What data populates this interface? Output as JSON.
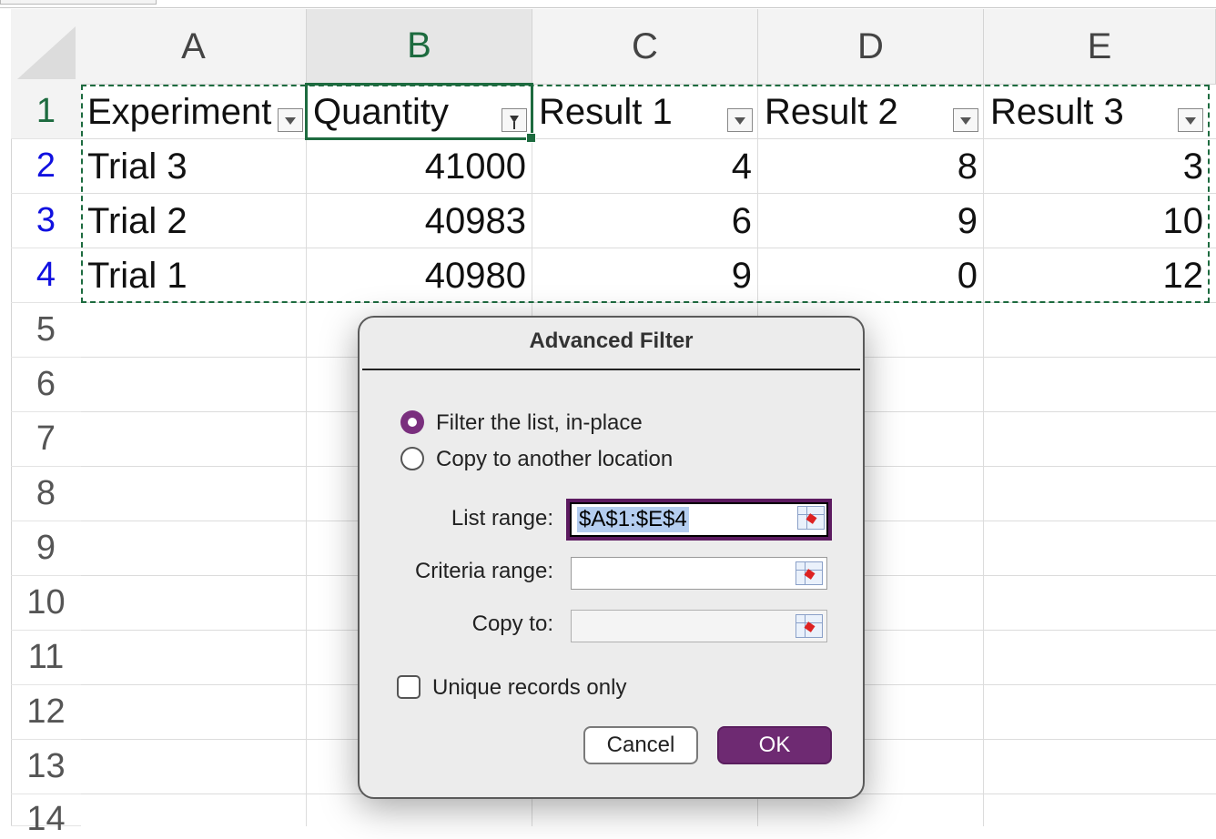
{
  "columns": [
    "A",
    "B",
    "C",
    "D",
    "E"
  ],
  "rows": [
    "1",
    "2",
    "3",
    "4",
    "5",
    "6",
    "7",
    "8",
    "9",
    "10",
    "11",
    "12",
    "13",
    "14"
  ],
  "headers": [
    "Experiment",
    "Quantity",
    "Result 1",
    "Result 2",
    "Result 3"
  ],
  "data": [
    [
      "Trial 3",
      "41000",
      "4",
      "8",
      "3"
    ],
    [
      "Trial 2",
      "40983",
      "6",
      "9",
      "10"
    ],
    [
      "Trial 1",
      "40980",
      "9",
      "0",
      "12"
    ]
  ],
  "dialog": {
    "title": "Advanced Filter",
    "option_inplace": "Filter the list, in-place",
    "option_copy": "Copy to another location",
    "list_range_label": "List range:",
    "list_range_value": "$A$1:$E$4",
    "criteria_range_label": "Criteria range:",
    "criteria_range_value": "",
    "copy_to_label": "Copy to:",
    "copy_to_value": "",
    "unique_label": "Unique records only",
    "cancel_label": "Cancel",
    "ok_label": "OK"
  },
  "colors": {
    "accent": "#6e2a72",
    "selection": "#1d6b3f",
    "row_number": "#1010e0"
  },
  "icons": {
    "filter_dropdown": "dropdown-arrow-icon",
    "active_filter": "funnel-icon",
    "range_picker": "range-picker-icon"
  }
}
